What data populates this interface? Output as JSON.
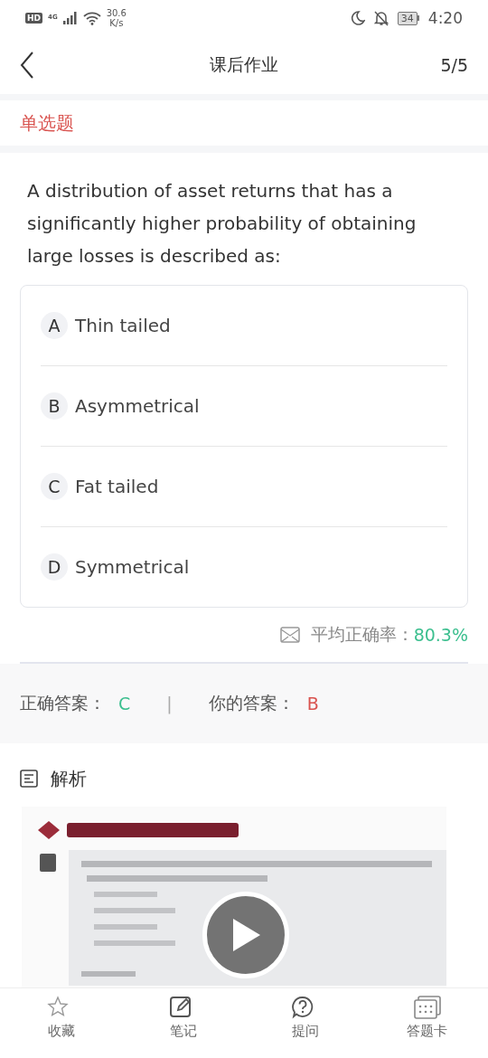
{
  "status_bar": {
    "hd_badge": "HD",
    "network_type": "4G",
    "speed": "30.6",
    "speed_unit": "K/s",
    "battery": "34",
    "time": "4:20"
  },
  "header": {
    "title": "课后作业",
    "progress": "5/5"
  },
  "question": {
    "type_label": "单选题",
    "text": "A distribution of asset returns that has a significantly higher probability of obtaining large losses is described as:",
    "options": [
      {
        "letter": "A",
        "text": "Thin tailed"
      },
      {
        "letter": "B",
        "text": "Asymmetrical"
      },
      {
        "letter": "C",
        "text": "Fat tailed"
      },
      {
        "letter": "D",
        "text": "Symmetrical"
      }
    ]
  },
  "accuracy": {
    "label": "平均正确率：",
    "value": "80.3%"
  },
  "answers": {
    "correct_label": "正确答案：",
    "correct": "C",
    "separator": "|",
    "yours_label": "你的答案：",
    "yours": "B"
  },
  "analysis": {
    "title": "解析"
  },
  "bottom_nav": [
    {
      "kind": "star",
      "label": "收藏"
    },
    {
      "kind": "note",
      "label": "笔记"
    },
    {
      "kind": "question",
      "label": "提问"
    },
    {
      "kind": "card",
      "label": "答题卡"
    }
  ]
}
